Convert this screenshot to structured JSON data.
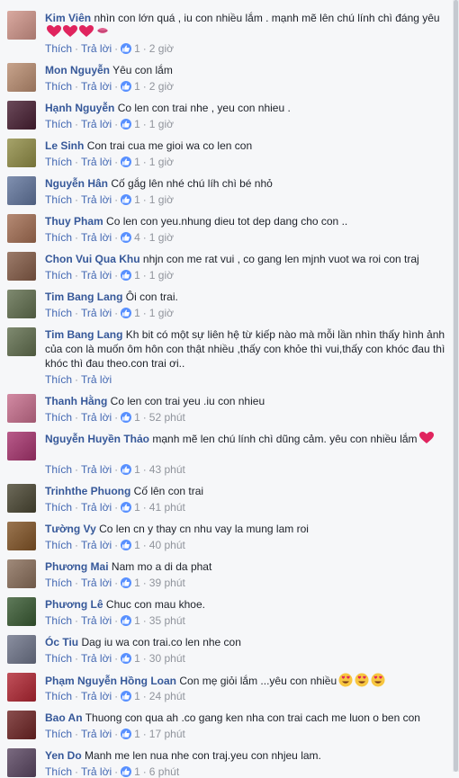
{
  "actions": {
    "like_label": "Thích",
    "reply_label": "Trả lời"
  },
  "comments": [
    {
      "author": "Kim Viên",
      "text": "nhìn con lớn quá , iu con nhiều lắm . mạnh mẽ lên chú lính chì đáng yêu",
      "emojis": [
        "heart",
        "heart",
        "heart",
        "kiss"
      ],
      "likes": "1",
      "time": "2 giờ",
      "avatar_color": "#d9a9a0"
    },
    {
      "author": "Mon Nguyễn",
      "text": "Yêu con lắm",
      "likes": "1",
      "time": "2 giờ",
      "avatar_color": "#c7a38c"
    },
    {
      "author": "Hạnh Nguyễn",
      "text": "Co len con trai nhe , yeu con nhieu .",
      "likes": "1",
      "time": "1 giờ",
      "avatar_color": "#6b4a5a"
    },
    {
      "author": "Le Sinh",
      "text": "Con trai cua me gioi wa co len con",
      "likes": "1",
      "time": "1 giờ",
      "avatar_color": "#a6a36a"
    },
    {
      "author": "Nguyễn Hân",
      "text": "Cố gắg lên nhé chú líh chì bé nhỏ",
      "likes": "1",
      "time": "1 giờ",
      "avatar_color": "#8090b0"
    },
    {
      "author": "Thuy Pham",
      "text": "Co len con yeu.nhung dieu tot dep dang cho con ..",
      "likes": "4",
      "time": "1 giờ",
      "avatar_color": "#b58a74"
    },
    {
      "author": "Chon Vui Qua Khu",
      "text": "nhjn con me rat vui , co gang len mjnh vuot wa roi con traj",
      "likes": "1",
      "time": "1 giờ",
      "avatar_color": "#9c7b6a"
    },
    {
      "author": "Tim Bang Lang",
      "text": "Ôi con trai.",
      "likes": "1",
      "time": "1 giờ",
      "avatar_color": "#7f8a70"
    },
    {
      "author": "Tim Bang Lang",
      "text": "Kh bit có một sự liên hệ từ kiếp nào mà mỗi lần nhìn thấy hình ảnh của con là muốn ôm hôn con thật nhiều ,thấy con khỏe thì vui,thấy con khóc đau thì khóc thì đau theo.con trai ơi..",
      "likes": "",
      "time": "",
      "avatar_color": "#7f8a70"
    },
    {
      "author": "Thanh Hằng",
      "text": "Co len con trai yeu .iu con nhieu",
      "likes": "1",
      "time": "52 phút",
      "avatar_color": "#d28aa3"
    },
    {
      "author": "Nguyễn Huyền Thảo",
      "text": "mạnh mẽ len chú lính chì dũng cảm. yêu con nhiều lắm",
      "emojis": [
        "heart"
      ],
      "likes": "1",
      "time": "43 phút",
      "avatar_color": "#b85b8a"
    },
    {
      "author": "Trinhthe Phuong",
      "text": "Cố lên con trai",
      "likes": "1",
      "time": "41 phút",
      "avatar_color": "#6d6a5a"
    },
    {
      "author": "Tường Vy",
      "text": "Co len cn y thay cn nhu vay la mung lam roi",
      "likes": "1",
      "time": "40 phút",
      "avatar_color": "#9a7550"
    },
    {
      "author": "Phương Mai",
      "text": "Nam mo a di da phat",
      "likes": "1",
      "time": "39 phút",
      "avatar_color": "#a08a7a"
    },
    {
      "author": "Phương Lê",
      "text": "Chuc con mau khoe.",
      "likes": "1",
      "time": "35 phút",
      "avatar_color": "#5f7a5a"
    },
    {
      "author": "Óc Tiu",
      "text": "Dag iu wa con trai.co len nhe con",
      "likes": "1",
      "time": "30 phút",
      "avatar_color": "#8a8fa0"
    },
    {
      "author": "Phạm Nguyễn Hồng Loan",
      "text": "Con mẹ giỏi lắm ...yêu con nhiều",
      "emojis": [
        "hearteyes",
        "hearteyes",
        "hearteyes"
      ],
      "likes": "1",
      "time": "24 phút",
      "avatar_color": "#c0505a"
    },
    {
      "author": "Bao An",
      "text": "Thuong con qua ah .co gang ken nha con trai cach me luon o ben con",
      "likes": "1",
      "time": "17 phút",
      "avatar_color": "#8a4e4e"
    },
    {
      "author": "Yen Do",
      "text": "Manh me len nua nhe con traj.yeu con nhjeu lam.",
      "likes": "1",
      "time": "6 phút",
      "avatar_color": "#7a6a80"
    }
  ]
}
